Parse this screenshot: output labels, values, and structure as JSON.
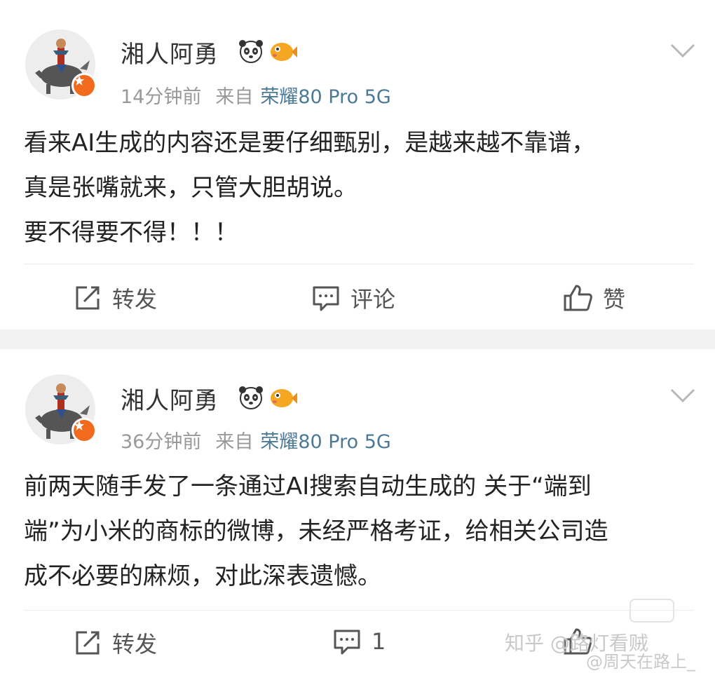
{
  "posts": [
    {
      "username": "湘人阿勇",
      "time": "14分钟前",
      "from_label": "来自",
      "device": "荣耀80 Pro 5G",
      "content_lines": [
        "看来AI生成的内容还是要仔细甄别，是越来越不靠谱，",
        "真是张嘴就来，只管大胆胡说。",
        "要不得要不得！！！"
      ],
      "actions": {
        "repost": "转发",
        "comment": "评论",
        "like": "赞"
      }
    },
    {
      "username": "湘人阿勇",
      "time": "36分钟前",
      "from_label": "来自",
      "device": "荣耀80 Pro 5G",
      "content_lines": [
        "前两天随手发了一条通过AI搜索自动生成的 关于“端到",
        "端”为小米的商标的微博，未经严格考证，给相关公司造",
        "成不必要的麻烦，对此深表遗憾。"
      ],
      "actions": {
        "repost": "转发",
        "comment": "1",
        "like": ""
      }
    }
  ],
  "watermarks": {
    "zhihu": "知乎 @路灯看贼",
    "weibo": "@周天在路上_"
  },
  "icons": {
    "avatar_badge": "verified-badge-icon",
    "emoji1": "panda-emoji-icon",
    "emoji2": "fish-emoji-icon",
    "chevron": "chevron-down-icon",
    "repost": "repost-icon",
    "comment": "comment-icon",
    "like": "thumbs-up-icon"
  },
  "colors": {
    "device_link": "#4c7a96",
    "badge": "#f26a1b",
    "meta_text": "#999999"
  }
}
